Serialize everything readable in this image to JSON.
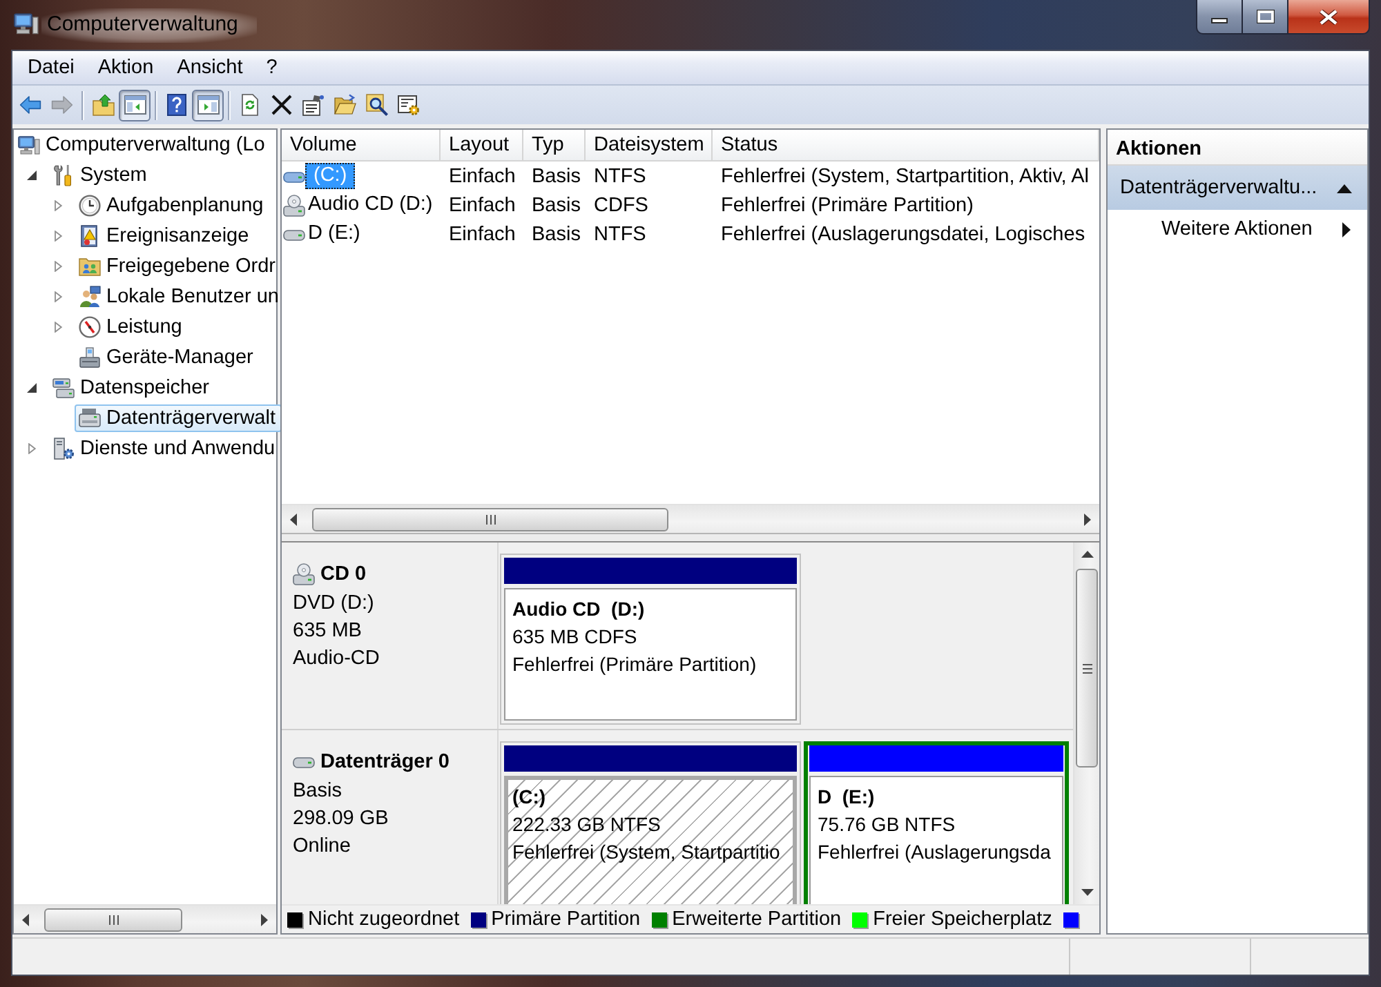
{
  "window": {
    "title": "Computerverwaltung"
  },
  "menu": [
    "Datei",
    "Aktion",
    "Ansicht",
    "?"
  ],
  "toolbar": [
    [
      {
        "pressed": false,
        "disabled": false
      },
      {
        "pressed": false,
        "disabled": true
      }
    ],
    [
      {
        "pressed": false,
        "disabled": false
      },
      {
        "pressed": true,
        "disabled": false
      }
    ],
    [
      {
        "pressed": false,
        "disabled": false
      },
      {
        "pressed": true,
        "disabled": false
      }
    ],
    [
      {
        "pressed": false,
        "disabled": false
      },
      {
        "pressed": false,
        "disabled": false
      },
      {
        "pressed": false,
        "disabled": false
      },
      {
        "pressed": false,
        "disabled": false
      },
      {
        "pressed": false,
        "disabled": false
      },
      {
        "pressed": false,
        "disabled": false
      }
    ]
  ],
  "tree": [
    {
      "label": "Computerverwaltung (Lo",
      "selected": false,
      "children": [
        {
          "label": "System",
          "selected": false,
          "expanded": true,
          "children": [
            {
              "label": "Aufgabenplanung",
              "selected": false,
              "expanded": false
            },
            {
              "label": "Ereignisanzeige",
              "selected": false,
              "expanded": false
            },
            {
              "label": "Freigegebene Ordr",
              "selected": false,
              "expanded": false
            },
            {
              "label": "Lokale Benutzer un",
              "selected": false,
              "expanded": false
            },
            {
              "label": "Leistung",
              "selected": false,
              "expanded": false
            },
            {
              "label": "Geräte-Manager",
              "selected": false
            }
          ]
        },
        {
          "label": "Datenspeicher",
          "selected": false,
          "expanded": true,
          "children": [
            {
              "label": "Datenträgerverwalt",
              "selected": true
            }
          ]
        },
        {
          "label": "Dienste und Anwendu",
          "selected": false,
          "expanded": false
        }
      ]
    }
  ],
  "table": {
    "columns": [
      "Volume",
      "Layout",
      "Typ",
      "Dateisystem",
      "Status"
    ],
    "rows": [
      {
        "selected": true,
        "cells": [
          "(C:)",
          "Einfach",
          "Basis",
          "NTFS",
          "Fehlerfrei (System, Startpartition, Aktiv, Al"
        ]
      },
      {
        "selected": false,
        "cells": [
          "Audio CD (D:)",
          "Einfach",
          "Basis",
          "CDFS",
          "Fehlerfrei (Primäre Partition)"
        ]
      },
      {
        "selected": false,
        "cells": [
          "D (E:)",
          "Einfach",
          "Basis",
          "NTFS",
          "Fehlerfrei (Auslagerungsdatei, Logisches"
        ]
      }
    ]
  },
  "disks": [
    {
      "name": "CD 0",
      "info": [
        "DVD (D:)",
        "635 MB",
        "Audio-CD"
      ],
      "partitions": [
        {
          "title": "Audio CD  (D:)",
          "size": "635 MB CDFS",
          "status": "Fehlerfrei (Primäre Partition)",
          "color": "#000080",
          "selected": false,
          "extended": false
        }
      ]
    },
    {
      "name": "Datenträger 0",
      "info": [
        "Basis",
        "298.09 GB",
        "Online"
      ],
      "partitions": [
        {
          "title": "(C:)",
          "size": "222.33 GB NTFS",
          "status": "Fehlerfrei (System, Startpartitio",
          "color": "#000080",
          "selected": true,
          "extended": false
        },
        {
          "title": "D  (E:)",
          "size": "75.76 GB NTFS",
          "status": "Fehlerfrei (Auslagerungsda",
          "color": "#0000ff",
          "selected": false,
          "extended": true
        }
      ]
    }
  ],
  "legend": [
    {
      "label": "Nicht zugeordnet",
      "color": "#000000"
    },
    {
      "label": "Primäre Partition",
      "color": "#000080"
    },
    {
      "label": "Erweiterte Partition",
      "color": "#008000"
    },
    {
      "label": "Freier Speicherplatz",
      "color": "#00ff00"
    },
    {
      "color": "#0000ff"
    }
  ],
  "actions": {
    "title": "Aktionen",
    "sections": [
      {
        "title": "Datenträgerverwaltu...",
        "expanded": true,
        "items": [
          {
            "label": "Weitere Aktionen",
            "submenu": true
          }
        ]
      }
    ]
  }
}
